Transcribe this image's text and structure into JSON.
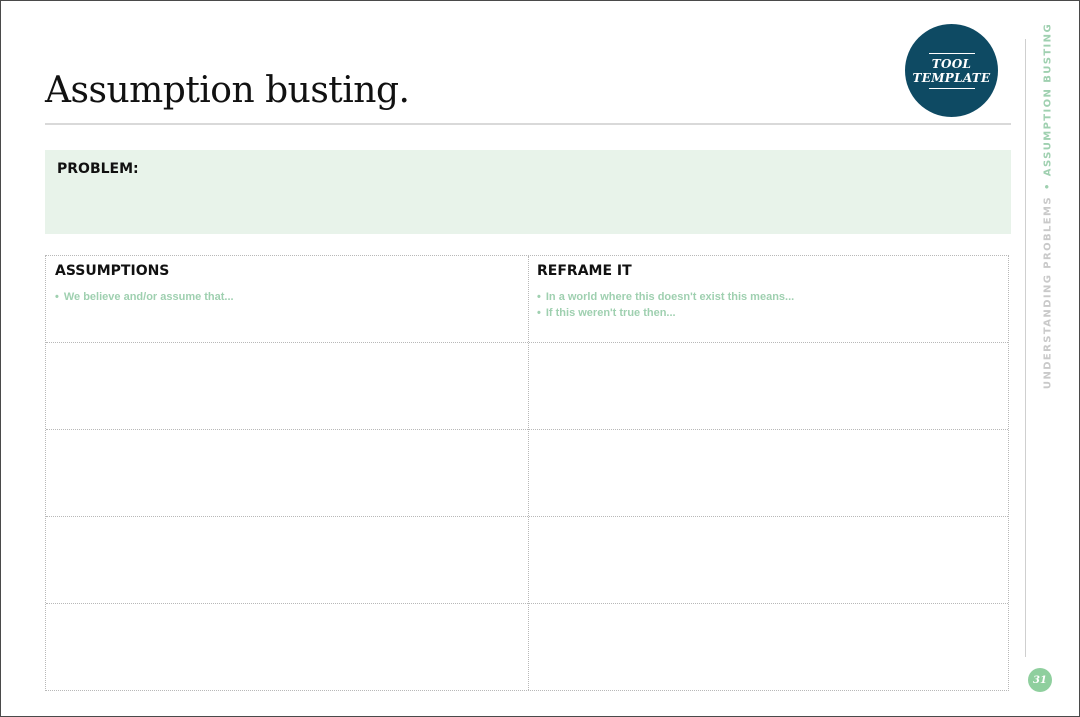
{
  "header": {
    "title": "Assumption busting.",
    "badge_line1": "TOOL",
    "badge_line2": "TEMPLATE"
  },
  "problem": {
    "label": "PROBLEM:"
  },
  "table": {
    "columns": [
      {
        "heading": "ASSUMPTIONS",
        "hints": [
          "We believe and/or assume that..."
        ]
      },
      {
        "heading": "REFRAME IT",
        "hints": [
          "In a world where this doesn't exist this means...",
          "If this weren't true then..."
        ]
      }
    ],
    "blank_rows": 4
  },
  "sidebar": {
    "section": "UNDERSTANDING PROBLEMS",
    "separator": "•",
    "topic": "ASSUMPTION BUSTING"
  },
  "footer": {
    "page_number": "31"
  },
  "colors": {
    "badge": "#0e4a63",
    "problem_bg": "#e8f3ea",
    "accent_green": "#9fd0b0",
    "page_number_bg": "#8fcf9e"
  }
}
